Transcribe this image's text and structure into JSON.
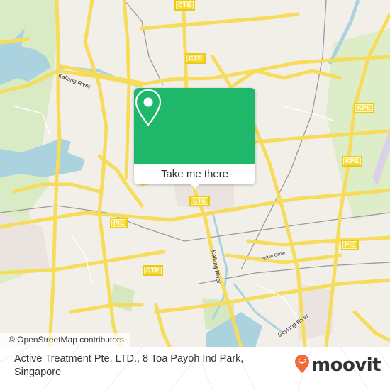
{
  "map": {
    "highway_shields": [
      {
        "label": "CTE",
        "id": "cte-top"
      },
      {
        "label": "CTE",
        "id": "cte-upper"
      },
      {
        "label": "CTE",
        "id": "cte-center"
      },
      {
        "label": "CTE",
        "id": "cte-lower"
      },
      {
        "label": "PIE",
        "id": "pie-west"
      },
      {
        "label": "PIE",
        "id": "pie-east"
      },
      {
        "label": "KPE",
        "id": "kpe-north"
      },
      {
        "label": "KPE",
        "id": "kpe-south"
      }
    ],
    "place_labels": {
      "kallang_river_upper": "Kallang River",
      "kallang_river_lower": "Kallang River",
      "geylang_river": "Geylang River",
      "pelton_canal": "Pelton Canal"
    },
    "colors": {
      "land": "#f2efe9",
      "road": "#f7dc5c",
      "water": "#aad3df",
      "park": "#d6eac0"
    }
  },
  "popup": {
    "icon": "map-pin-icon",
    "button_label": "Take me there",
    "accent_color": "#1fb76a"
  },
  "attribution": {
    "text": "© OpenStreetMap contributors"
  },
  "footer": {
    "address": "Active Treatment Pte. LTD., 8 Toa Payoh Ind Park, Singapore",
    "brand_name": "moovit",
    "brand_color": "#f26b3a"
  }
}
